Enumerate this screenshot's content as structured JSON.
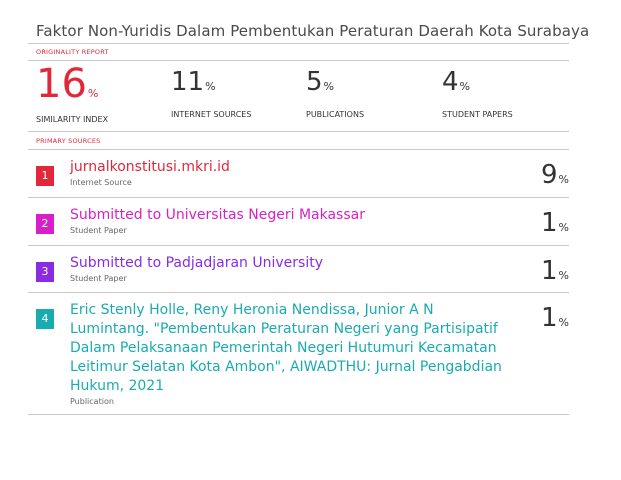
{
  "title": "Faktor Non-Yuridis Dalam Pembentukan Peraturan Daerah Kota Surabaya",
  "originality_report_label": "ORIGINALITY REPORT",
  "stats": [
    {
      "value": "16",
      "unit": "%",
      "label": "SIMILARITY INDEX",
      "color": "#e0283a"
    },
    {
      "value": "11",
      "unit": "%",
      "label": "INTERNET SOURCES",
      "color": "#333333"
    },
    {
      "value": "5",
      "unit": "%",
      "label": "PUBLICATIONS",
      "color": "#333333"
    },
    {
      "value": "4",
      "unit": "%",
      "label": "STUDENT PAPERS",
      "color": "#333333"
    }
  ],
  "primary_sources_label": "PRIMARY SOURCES",
  "sources": [
    {
      "rank": "1",
      "name": "jurnalkonstitusi.mkri.id",
      "type": "Internet Source",
      "value": "9",
      "unit": "%",
      "color": "#e0283a"
    },
    {
      "rank": "2",
      "name": "Submitted to Universitas Negeri Makassar",
      "type": "Student Paper",
      "value": "1",
      "unit": "%",
      "color": "#d81fc8"
    },
    {
      "rank": "3",
      "name": "Submitted to Padjadjaran University",
      "type": "Student Paper",
      "value": "1",
      "unit": "%",
      "color": "#8a2be2"
    },
    {
      "rank": "4",
      "name": "Eric Stenly Holle, Reny Heronia Nendissa, Junior A N Lumintang. \"Pembentukan Peraturan Negeri yang Partisipatif Dalam Pelaksanaan Pemerintah Negeri Hutumuri Kecamatan Leitimur Selatan Kota Ambon\", AIWADTHU: Jurnal Pengabdian Hukum, 2021",
      "type": "Publication",
      "value": "1",
      "unit": "%",
      "color": "#1aabb1"
    }
  ]
}
